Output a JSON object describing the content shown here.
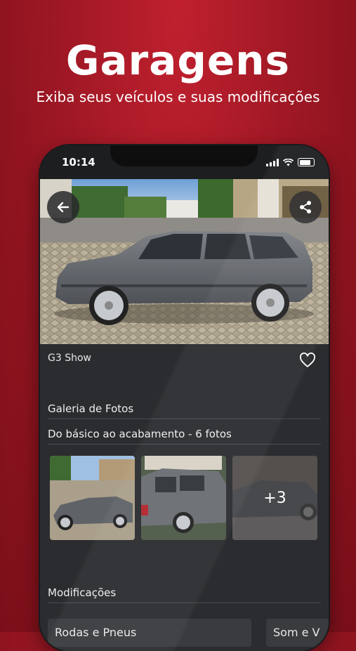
{
  "promo": {
    "title": "Garagens",
    "subtitle": "Exiba seus veículos e suas modificações"
  },
  "status_bar": {
    "time": "10:14",
    "icons": [
      "cellular-signal-icon",
      "wifi-icon",
      "battery-icon"
    ]
  },
  "hero": {
    "back_icon": "arrow-left-icon",
    "share_icon": "share-icon"
  },
  "vehicle": {
    "name": "G3 Show",
    "favorite_icon": "heart-outline-icon"
  },
  "gallery": {
    "section_title": "Galeria de Fotos",
    "album_title": "Do básico ao acabamento - 6 fotos",
    "more_count": "+3"
  },
  "modifications": {
    "section_title": "Modificações",
    "chips": [
      "Rodas e Pneus",
      "Som e V"
    ]
  },
  "colors": {
    "background": "#a01825",
    "app_surface": "#2b2c2f",
    "status_bar": "#1d1e20",
    "text": "#ffffff"
  }
}
